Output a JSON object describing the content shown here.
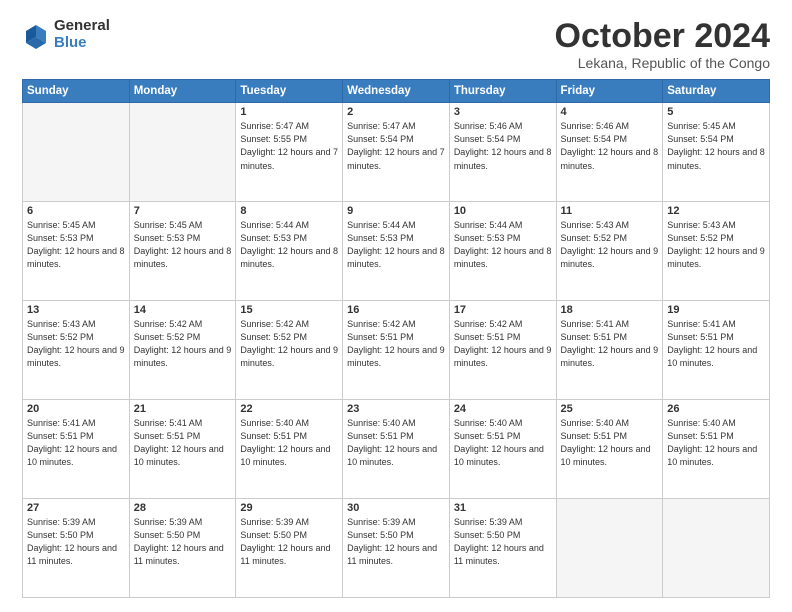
{
  "logo": {
    "general": "General",
    "blue": "Blue"
  },
  "header": {
    "title": "October 2024",
    "subtitle": "Lekana, Republic of the Congo"
  },
  "weekdays": [
    "Sunday",
    "Monday",
    "Tuesday",
    "Wednesday",
    "Thursday",
    "Friday",
    "Saturday"
  ],
  "weeks": [
    [
      {
        "day": "",
        "sunrise": "",
        "sunset": "",
        "daylight": ""
      },
      {
        "day": "",
        "sunrise": "",
        "sunset": "",
        "daylight": ""
      },
      {
        "day": "1",
        "sunrise": "Sunrise: 5:47 AM",
        "sunset": "Sunset: 5:55 PM",
        "daylight": "Daylight: 12 hours and 7 minutes."
      },
      {
        "day": "2",
        "sunrise": "Sunrise: 5:47 AM",
        "sunset": "Sunset: 5:54 PM",
        "daylight": "Daylight: 12 hours and 7 minutes."
      },
      {
        "day": "3",
        "sunrise": "Sunrise: 5:46 AM",
        "sunset": "Sunset: 5:54 PM",
        "daylight": "Daylight: 12 hours and 8 minutes."
      },
      {
        "day": "4",
        "sunrise": "Sunrise: 5:46 AM",
        "sunset": "Sunset: 5:54 PM",
        "daylight": "Daylight: 12 hours and 8 minutes."
      },
      {
        "day": "5",
        "sunrise": "Sunrise: 5:45 AM",
        "sunset": "Sunset: 5:54 PM",
        "daylight": "Daylight: 12 hours and 8 minutes."
      }
    ],
    [
      {
        "day": "6",
        "sunrise": "Sunrise: 5:45 AM",
        "sunset": "Sunset: 5:53 PM",
        "daylight": "Daylight: 12 hours and 8 minutes."
      },
      {
        "day": "7",
        "sunrise": "Sunrise: 5:45 AM",
        "sunset": "Sunset: 5:53 PM",
        "daylight": "Daylight: 12 hours and 8 minutes."
      },
      {
        "day": "8",
        "sunrise": "Sunrise: 5:44 AM",
        "sunset": "Sunset: 5:53 PM",
        "daylight": "Daylight: 12 hours and 8 minutes."
      },
      {
        "day": "9",
        "sunrise": "Sunrise: 5:44 AM",
        "sunset": "Sunset: 5:53 PM",
        "daylight": "Daylight: 12 hours and 8 minutes."
      },
      {
        "day": "10",
        "sunrise": "Sunrise: 5:44 AM",
        "sunset": "Sunset: 5:53 PM",
        "daylight": "Daylight: 12 hours and 8 minutes."
      },
      {
        "day": "11",
        "sunrise": "Sunrise: 5:43 AM",
        "sunset": "Sunset: 5:52 PM",
        "daylight": "Daylight: 12 hours and 9 minutes."
      },
      {
        "day": "12",
        "sunrise": "Sunrise: 5:43 AM",
        "sunset": "Sunset: 5:52 PM",
        "daylight": "Daylight: 12 hours and 9 minutes."
      }
    ],
    [
      {
        "day": "13",
        "sunrise": "Sunrise: 5:43 AM",
        "sunset": "Sunset: 5:52 PM",
        "daylight": "Daylight: 12 hours and 9 minutes."
      },
      {
        "day": "14",
        "sunrise": "Sunrise: 5:42 AM",
        "sunset": "Sunset: 5:52 PM",
        "daylight": "Daylight: 12 hours and 9 minutes."
      },
      {
        "day": "15",
        "sunrise": "Sunrise: 5:42 AM",
        "sunset": "Sunset: 5:52 PM",
        "daylight": "Daylight: 12 hours and 9 minutes."
      },
      {
        "day": "16",
        "sunrise": "Sunrise: 5:42 AM",
        "sunset": "Sunset: 5:51 PM",
        "daylight": "Daylight: 12 hours and 9 minutes."
      },
      {
        "day": "17",
        "sunrise": "Sunrise: 5:42 AM",
        "sunset": "Sunset: 5:51 PM",
        "daylight": "Daylight: 12 hours and 9 minutes."
      },
      {
        "day": "18",
        "sunrise": "Sunrise: 5:41 AM",
        "sunset": "Sunset: 5:51 PM",
        "daylight": "Daylight: 12 hours and 9 minutes."
      },
      {
        "day": "19",
        "sunrise": "Sunrise: 5:41 AM",
        "sunset": "Sunset: 5:51 PM",
        "daylight": "Daylight: 12 hours and 10 minutes."
      }
    ],
    [
      {
        "day": "20",
        "sunrise": "Sunrise: 5:41 AM",
        "sunset": "Sunset: 5:51 PM",
        "daylight": "Daylight: 12 hours and 10 minutes."
      },
      {
        "day": "21",
        "sunrise": "Sunrise: 5:41 AM",
        "sunset": "Sunset: 5:51 PM",
        "daylight": "Daylight: 12 hours and 10 minutes."
      },
      {
        "day": "22",
        "sunrise": "Sunrise: 5:40 AM",
        "sunset": "Sunset: 5:51 PM",
        "daylight": "Daylight: 12 hours and 10 minutes."
      },
      {
        "day": "23",
        "sunrise": "Sunrise: 5:40 AM",
        "sunset": "Sunset: 5:51 PM",
        "daylight": "Daylight: 12 hours and 10 minutes."
      },
      {
        "day": "24",
        "sunrise": "Sunrise: 5:40 AM",
        "sunset": "Sunset: 5:51 PM",
        "daylight": "Daylight: 12 hours and 10 minutes."
      },
      {
        "day": "25",
        "sunrise": "Sunrise: 5:40 AM",
        "sunset": "Sunset: 5:51 PM",
        "daylight": "Daylight: 12 hours and 10 minutes."
      },
      {
        "day": "26",
        "sunrise": "Sunrise: 5:40 AM",
        "sunset": "Sunset: 5:51 PM",
        "daylight": "Daylight: 12 hours and 10 minutes."
      }
    ],
    [
      {
        "day": "27",
        "sunrise": "Sunrise: 5:39 AM",
        "sunset": "Sunset: 5:50 PM",
        "daylight": "Daylight: 12 hours and 11 minutes."
      },
      {
        "day": "28",
        "sunrise": "Sunrise: 5:39 AM",
        "sunset": "Sunset: 5:50 PM",
        "daylight": "Daylight: 12 hours and 11 minutes."
      },
      {
        "day": "29",
        "sunrise": "Sunrise: 5:39 AM",
        "sunset": "Sunset: 5:50 PM",
        "daylight": "Daylight: 12 hours and 11 minutes."
      },
      {
        "day": "30",
        "sunrise": "Sunrise: 5:39 AM",
        "sunset": "Sunset: 5:50 PM",
        "daylight": "Daylight: 12 hours and 11 minutes."
      },
      {
        "day": "31",
        "sunrise": "Sunrise: 5:39 AM",
        "sunset": "Sunset: 5:50 PM",
        "daylight": "Daylight: 12 hours and 11 minutes."
      },
      {
        "day": "",
        "sunrise": "",
        "sunset": "",
        "daylight": ""
      },
      {
        "day": "",
        "sunrise": "",
        "sunset": "",
        "daylight": ""
      }
    ]
  ]
}
